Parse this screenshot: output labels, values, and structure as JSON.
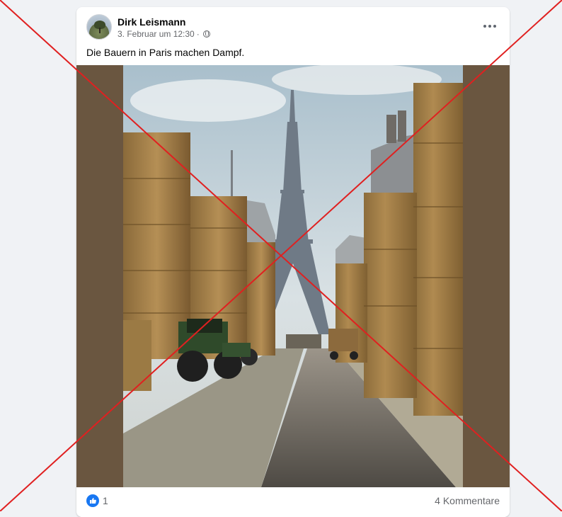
{
  "post": {
    "author": "Dirk Leismann",
    "timestamp": "3. Februar um 12:30",
    "separator": "·",
    "audience_icon": "globe-icon",
    "text": "Die Bauern in Paris machen Dampf.",
    "more_icon": "more-options-icon"
  },
  "reactions": {
    "icon": "like-icon",
    "count": "1",
    "comments": "4 Kommentare"
  },
  "overlay": {
    "type": "red-cross",
    "color": "#e02020"
  },
  "colors": {
    "facebook_blue": "#1877f2",
    "media_background": "#6a5640",
    "page_background": "#f0f2f5"
  }
}
